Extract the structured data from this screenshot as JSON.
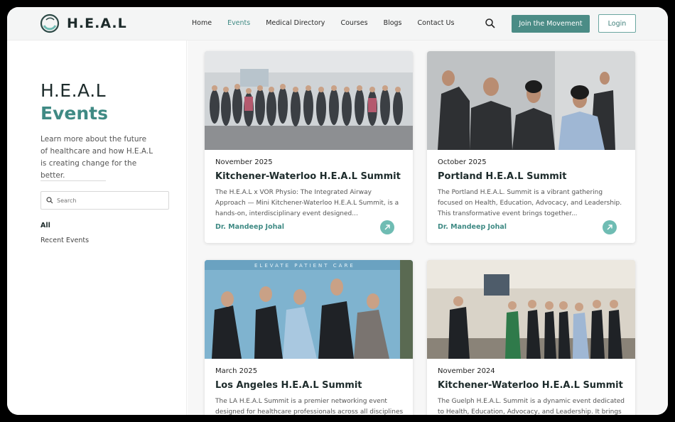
{
  "header": {
    "logo_text": "H.E.A.L",
    "nav": [
      "Home",
      "Events",
      "Medical Directory",
      "Courses",
      "Blogs",
      "Contact Us"
    ],
    "active_nav": "Events",
    "join_label": "Join the Movement",
    "login_label": "Login"
  },
  "sidebar": {
    "title_line1": "H.E.A.L",
    "title_line2": "Events",
    "description": "Learn more about the future of healthcare and how H.E.A.L is creating change for the better.",
    "search_placeholder": "Search",
    "filters": [
      "All",
      "Recent Events"
    ]
  },
  "events": [
    {
      "date": "November 2025",
      "title": "Kitchener-Waterloo H.E.A.L Summit",
      "description": "The H.E.A.L x VOR Physio: The Integrated Airway Approach — Mini Kitchener-Waterloo H.E.A.L Summit, is a hands-on, interdisciplinary event designed...",
      "author": "Dr. Mandeep Johal"
    },
    {
      "date": "October 2025",
      "title": "Portland H.E.A.L Summit",
      "description": "The Portland H.E.A.L. Summit is a vibrant gathering focused on Health, Education, Advocacy, and Leadership. This transformative event brings together...",
      "author": "Dr. Mandeep Johal"
    },
    {
      "date": "March 2025",
      "title": "Los Angeles H.E.A.L Summit",
      "description": "The LA H.E.A.L Summit is a premier networking event designed for healthcare professionals across all disciplines in",
      "author": ""
    },
    {
      "date": "November 2024",
      "title": "Kitchener-Waterloo H.E.A.L Summit",
      "description": "The Guelph H.E.A.L. Summit is a dynamic event dedicated to Health, Education, Advocacy, and Leadership. It brings",
      "author": ""
    }
  ],
  "banner_text": "ELEVATE PATIENT CARE",
  "colors": {
    "accent": "#4b8c86",
    "teal_text": "#3f8a84",
    "arrow_bg": "#6fbcb3"
  }
}
